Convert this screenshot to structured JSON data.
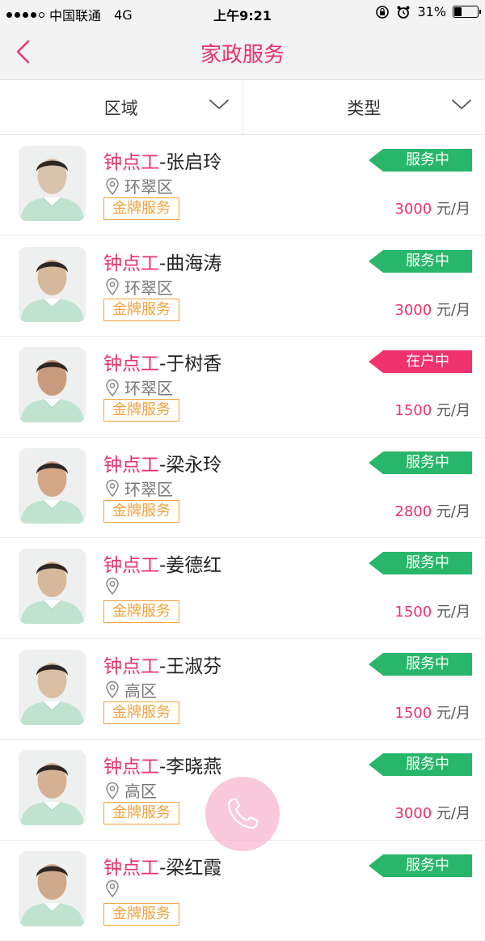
{
  "status_bar": {
    "carrier": "中国联通",
    "network": "4G",
    "time": "上午9:21",
    "battery": "31%"
  },
  "header": {
    "title": "家政服务"
  },
  "filters": [
    {
      "label": "区域"
    },
    {
      "label": "类型"
    }
  ],
  "colors": {
    "accent": "#e8336b",
    "serving": "#28b66a",
    "at_home": "#f0336e",
    "gold": "#f3a23b"
  },
  "list": [
    {
      "category": "钟点工",
      "name": "-张启玲",
      "location": "环翠区",
      "badge": "金牌服务",
      "status": "服务中",
      "status_type": "serving",
      "price": "3000",
      "unit": " 元/月"
    },
    {
      "category": "钟点工",
      "name": "-曲海涛",
      "location": "环翠区",
      "badge": "金牌服务",
      "status": "服务中",
      "status_type": "serving",
      "price": "3000",
      "unit": " 元/月"
    },
    {
      "category": "钟点工",
      "name": "-于树香",
      "location": "环翠区",
      "badge": "金牌服务",
      "status": "在户中",
      "status_type": "at_home",
      "price": "1500",
      "unit": " 元/月"
    },
    {
      "category": "钟点工",
      "name": "-梁永玲",
      "location": "环翠区",
      "badge": "金牌服务",
      "status": "服务中",
      "status_type": "serving",
      "price": "2800",
      "unit": " 元/月"
    },
    {
      "category": "钟点工",
      "name": "-姜德红",
      "location": "",
      "badge": "金牌服务",
      "status": "服务中",
      "status_type": "serving",
      "price": "1500",
      "unit": " 元/月"
    },
    {
      "category": "钟点工",
      "name": "-王淑芬",
      "location": "高区",
      "badge": "金牌服务",
      "status": "服务中",
      "status_type": "serving",
      "price": "1500",
      "unit": " 元/月"
    },
    {
      "category": "钟点工",
      "name": "-李晓燕",
      "location": "高区",
      "badge": "金牌服务",
      "status": "服务中",
      "status_type": "serving",
      "price": "3000",
      "unit": " 元/月"
    },
    {
      "category": "钟点工",
      "name": "-梁红霞",
      "location": "",
      "badge": "金牌服务",
      "status": "服务中",
      "status_type": "serving",
      "price": "",
      "unit": ""
    }
  ]
}
